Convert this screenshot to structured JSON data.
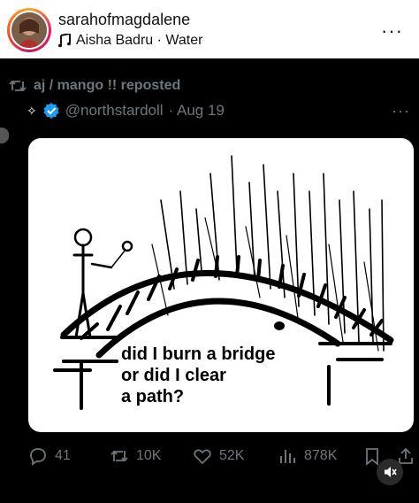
{
  "post": {
    "username": "sarahofmagdalene",
    "music": "Aisha Badru · Water",
    "more_label": "···"
  },
  "tweet": {
    "repost_text": "aj / mango !! reposted",
    "handle": "@northstardoll",
    "date": "· Aug 19",
    "sparkle": "✧",
    "more_label": "···",
    "image_caption": [
      "did I burn a bridge",
      "or did I clear",
      "a path?"
    ],
    "replies": "41",
    "reposts": "10K",
    "likes": "52K",
    "views": "878K"
  },
  "colors": {
    "verified_blue": "#1d9bf0",
    "muted_text": "#6e767d",
    "tweet_bg": "#000000"
  },
  "icons": [
    "music-note-icon",
    "repost-icon",
    "verified-badge-icon",
    "reply-icon",
    "heart-icon",
    "views-icon",
    "bookmark-icon",
    "share-icon",
    "mute-icon"
  ]
}
